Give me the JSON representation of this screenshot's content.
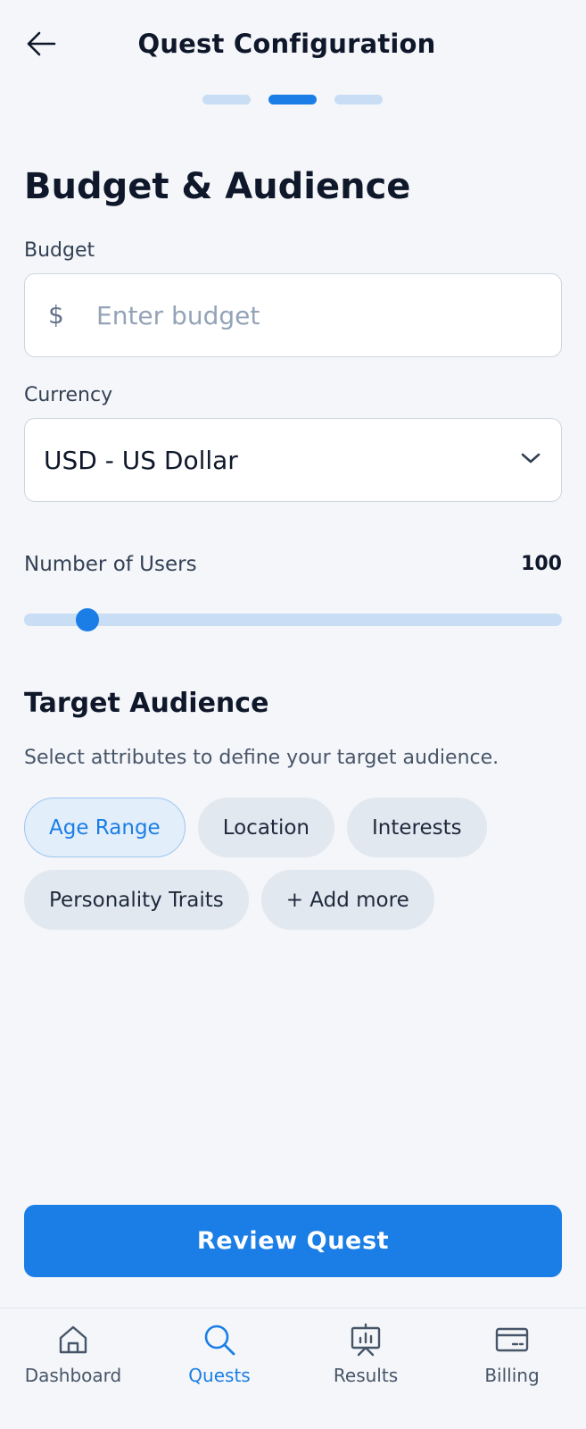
{
  "header": {
    "title": "Quest Configuration",
    "back_icon": "arrow-left-icon"
  },
  "progress": {
    "total_steps": 3,
    "current_step": 2
  },
  "section": {
    "title": "Budget & Audience"
  },
  "budget": {
    "label": "Budget",
    "currency_symbol": "$",
    "placeholder": "Enter budget",
    "value": ""
  },
  "currency": {
    "label": "Currency",
    "selected": "USD - US Dollar",
    "icon": "chevron-down-icon"
  },
  "users": {
    "label": "Number of Users",
    "value": "100",
    "slider_level": 0.117
  },
  "audience": {
    "title": "Target Audience",
    "description": "Select attributes to define your target audience.",
    "chips": [
      {
        "label": "Age Range",
        "selected": true
      },
      {
        "label": "Location",
        "selected": false
      },
      {
        "label": "Interests",
        "selected": false
      },
      {
        "label": "Personality Traits",
        "selected": false
      },
      {
        "label": "+ Add more",
        "selected": false
      }
    ]
  },
  "review_button": {
    "label": "Review Quest"
  },
  "tabs": [
    {
      "label": "Dashboard",
      "icon": "home-icon",
      "active": false
    },
    {
      "label": "Quests",
      "icon": "search-icon",
      "active": true
    },
    {
      "label": "Results",
      "icon": "presentation-chart-icon",
      "active": false
    },
    {
      "label": "Billing",
      "icon": "credit-card-icon",
      "active": false
    }
  ],
  "colors": {
    "accent": "#1a7ee6",
    "background": "#f4f6f9",
    "track": "#c9def4",
    "chip": "#e2e8f0",
    "chip_selected": "#e3eefb"
  }
}
